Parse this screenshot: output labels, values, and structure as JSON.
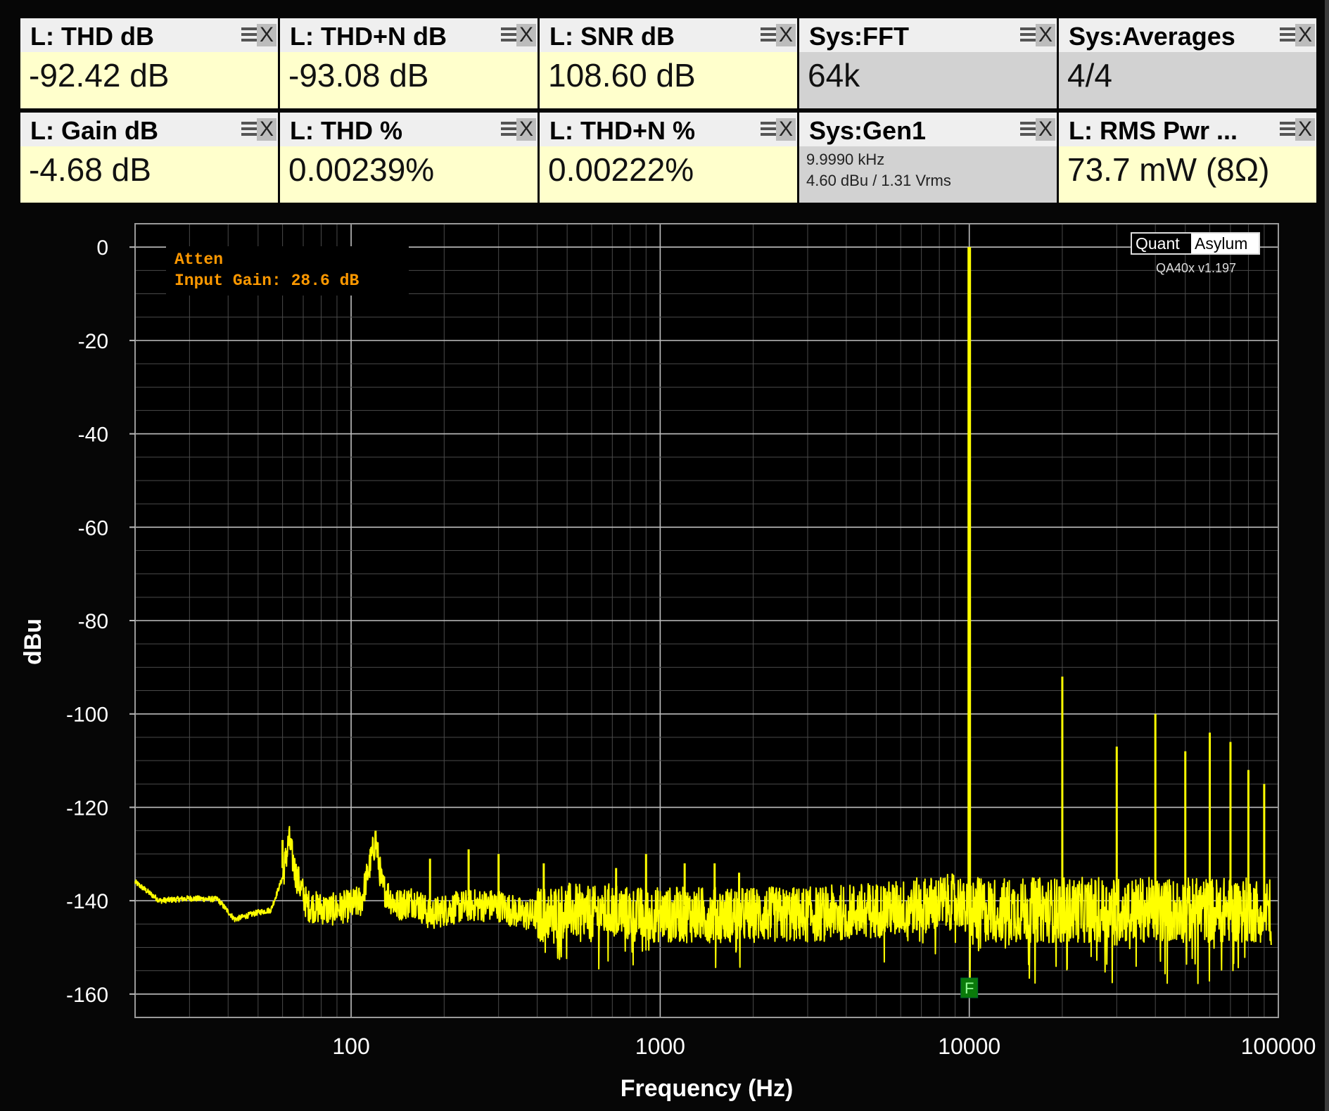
{
  "widgets": [
    {
      "title": "L: THD dB",
      "value": "-92.42 dB",
      "style": "yellow"
    },
    {
      "title": "L: THD+N dB",
      "value": "-93.08 dB",
      "style": "yellow"
    },
    {
      "title": "L: SNR dB",
      "value": "108.60 dB",
      "style": "yellow"
    },
    {
      "title": "Sys:FFT",
      "value": "64k",
      "style": "gray"
    },
    {
      "title": "Sys:Averages",
      "value": "4/4",
      "style": "gray"
    },
    {
      "title": "L: Gain dB",
      "value": "-4.68 dB",
      "style": "yellow"
    },
    {
      "title": "L: THD %",
      "value": "0.00239%",
      "style": "yellow"
    },
    {
      "title": "L: THD+N %",
      "value": "0.00222%",
      "style": "yellow"
    },
    {
      "title": "Sys:Gen1",
      "line1": "9.9990 kHz",
      "line2": "4.60 dBu  / 1.31 Vrms",
      "style": "gray"
    },
    {
      "title": "L: RMS Pwr ...",
      "value": "73.7 mW (8Ω)",
      "style": "yellow"
    }
  ],
  "widget_icons": {
    "menu": "menu-icon",
    "close": "close-icon",
    "close_glyph": "X"
  },
  "annotation": {
    "line1": "Atten",
    "line2": "Input Gain: 28.6 dB",
    "color": "#ff9900"
  },
  "brand": {
    "left": "Quant",
    "right": "Asylum",
    "version": "QA40x v1.197"
  },
  "marker": {
    "label": "F",
    "x": 10000,
    "color": "#0a7a0a"
  },
  "colors": {
    "trace": "#ffff00",
    "grid_major": "#bfbfbf",
    "grid_minor": "#4a4a4a",
    "plot_bg": "#000000"
  },
  "chart_data": {
    "type": "line",
    "xlabel": "Frequency (Hz)",
    "ylabel": "dBu",
    "xscale": "log",
    "xlim": [
      20,
      100000
    ],
    "ylim": [
      -165,
      5
    ],
    "xticks": [
      100,
      1000,
      10000,
      100000
    ],
    "xtick_labels": [
      "100",
      "1000",
      "10000",
      "100000"
    ],
    "yticks": [
      0,
      -20,
      -40,
      -60,
      -80,
      -100,
      -120,
      -140,
      -160
    ],
    "ytick_labels": [
      "0",
      "-20",
      "-40",
      "-60",
      "-80",
      "-100",
      "-120",
      "-140",
      "-160"
    ],
    "grid": true,
    "series": [
      {
        "x": [
          20,
          24,
          30,
          37,
          42,
          50,
          55,
          60,
          63,
          66,
          72,
          85,
          100,
          108,
          120,
          126,
          140,
          160,
          180,
          200,
          240,
          300,
          360,
          420,
          500,
          600,
          700,
          800,
          1000,
          1200,
          1500,
          2000,
          3000,
          5000,
          7000,
          9500,
          10000,
          10500,
          20000,
          30000,
          40000,
          50000,
          60000,
          70000,
          80000,
          90000,
          95000
        ],
        "y": [
          -136,
          -140,
          -139.5,
          -139.7,
          -144,
          -142.5,
          -142,
          -135,
          -127,
          -134,
          -141,
          -142,
          -141,
          -140,
          -127,
          -137,
          -141,
          -140,
          -143,
          -142,
          -141,
          -141,
          -143,
          -143,
          -142,
          -143,
          -142,
          -143,
          -143,
          -143,
          -143,
          -143,
          -143,
          -142,
          -141,
          -140,
          0,
          -142,
          -142,
          -142,
          -142,
          -142,
          -142,
          -142,
          -142,
          -142,
          -142
        ]
      }
    ],
    "peaks": [
      {
        "x": 60,
        "y": -127
      },
      {
        "x": 120,
        "y": -127
      },
      {
        "x": 180,
        "y": -131
      },
      {
        "x": 240,
        "y": -129
      },
      {
        "x": 300,
        "y": -130
      },
      {
        "x": 420,
        "y": -132
      },
      {
        "x": 720,
        "y": -133
      },
      {
        "x": 900,
        "y": -130
      },
      {
        "x": 1200,
        "y": -132
      },
      {
        "x": 1500,
        "y": -132
      },
      {
        "x": 1800,
        "y": -134
      },
      {
        "x": 10000,
        "y": 0
      },
      {
        "x": 20000,
        "y": -92
      },
      {
        "x": 30000,
        "y": -107
      },
      {
        "x": 40000,
        "y": -100
      },
      {
        "x": 50000,
        "y": -108
      },
      {
        "x": 60000,
        "y": -104
      },
      {
        "x": 70000,
        "y": -106
      },
      {
        "x": 80000,
        "y": -112
      },
      {
        "x": 90000,
        "y": -115
      }
    ]
  }
}
